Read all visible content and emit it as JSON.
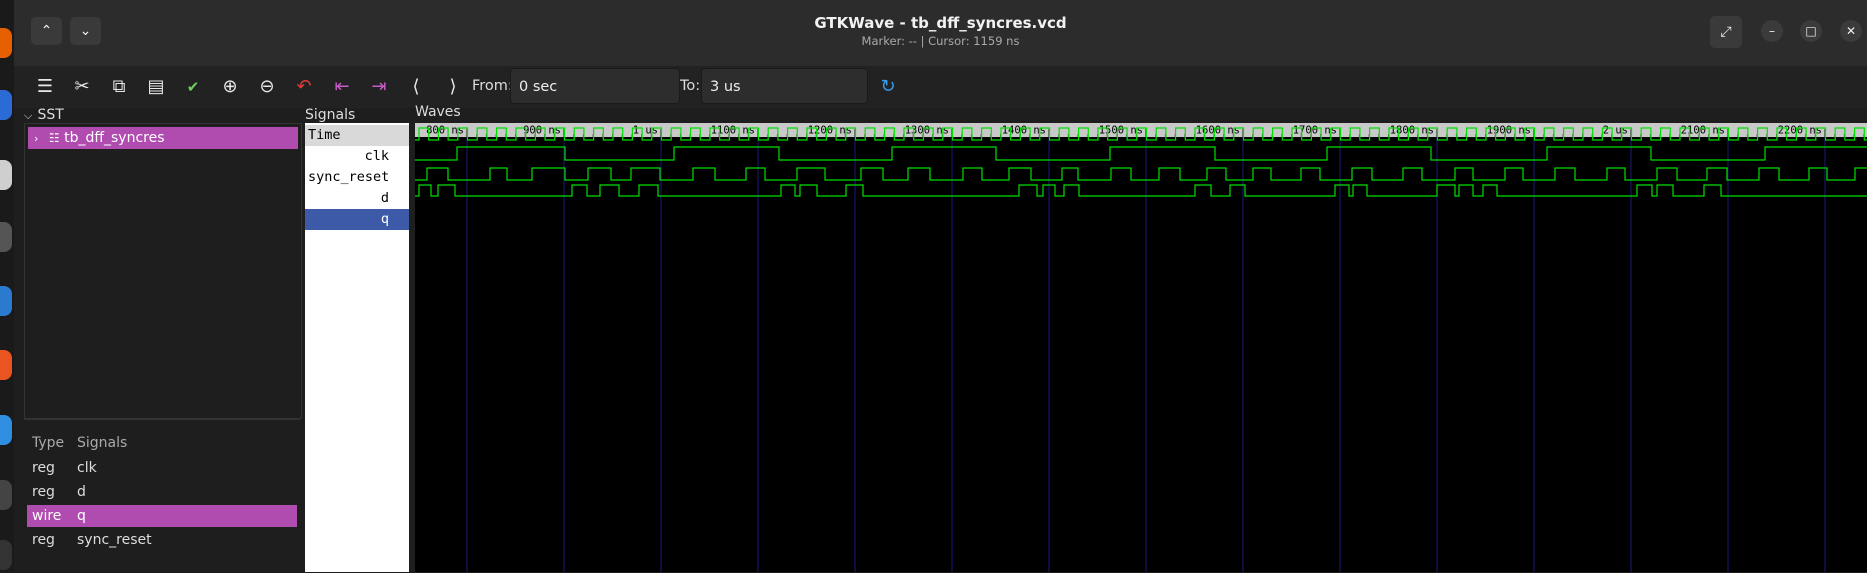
{
  "window": {
    "title": "GTKWave - tb_dff_syncres.vcd",
    "subtitle": "Marker: --  |  Cursor: 1159 ns"
  },
  "toolbar": {
    "from_label": "From:",
    "from_value": "0 sec",
    "to_label": "To:",
    "to_value": "3 us"
  },
  "sst": {
    "label": "SST",
    "tree_item": "tb_dff_syncres",
    "columns": {
      "type": "Type",
      "signals": "Signals"
    },
    "signals": [
      {
        "type": "reg",
        "name": "clk"
      },
      {
        "type": "reg",
        "name": "d"
      },
      {
        "type": "wire",
        "name": "q",
        "selected": true
      },
      {
        "type": "reg",
        "name": "sync_reset"
      }
    ]
  },
  "signals_panel": {
    "label": "Signals",
    "rows": [
      "Time",
      "clk",
      "sync_reset",
      "d",
      "q"
    ]
  },
  "waves": {
    "label": "Waves",
    "ticks": [
      "800 ns",
      "900 ns",
      "1 us",
      "1100 ns",
      "1200 ns",
      "1300 ns",
      "1400 ns",
      "1500 ns",
      "1600 ns",
      "1700 ns",
      "1800 ns",
      "1900 ns",
      "2 us",
      "2100 ns",
      "2200 ns"
    ]
  },
  "colors": {
    "accent": "#b04cb0",
    "selected_row": "#3d5aa8",
    "wave": "#00e000",
    "grid": "#1a1a80"
  }
}
